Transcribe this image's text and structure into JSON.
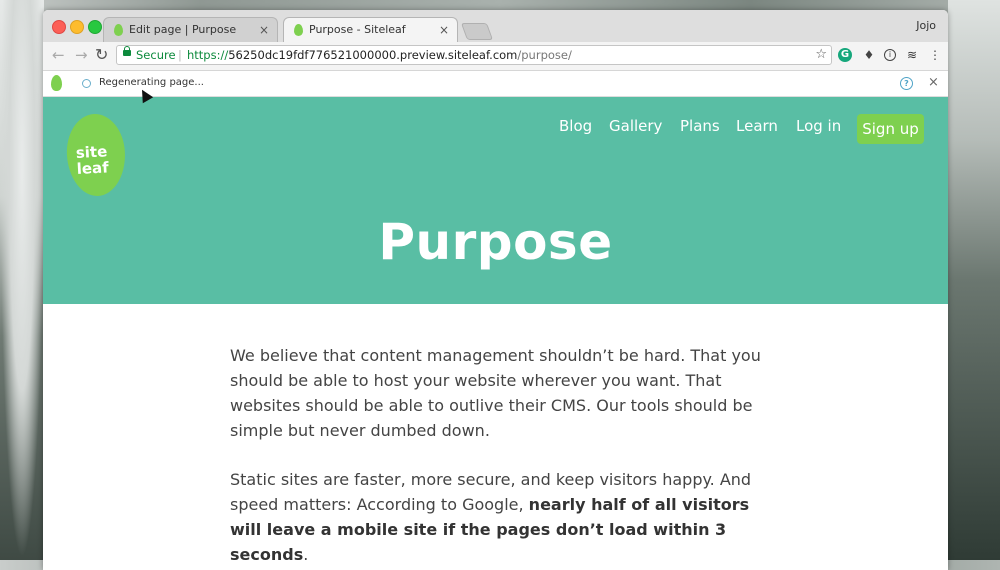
{
  "browser": {
    "tabs": [
      {
        "title": "Edit page | Purpose",
        "close": "×"
      },
      {
        "title": "Purpose - Siteleaf",
        "close": "×"
      }
    ],
    "profile": "Jojo",
    "nav": {
      "back": "←",
      "forward": "→",
      "reload": "↻"
    },
    "address": {
      "secure_label": "Secure",
      "separator": "|",
      "scheme": "https://",
      "host": "56250dc19fdf776521000000.preview.siteleaf.com",
      "path": "/purpose/"
    },
    "bookmark": "☆",
    "extensions": {
      "g": "G",
      "drop": "♦",
      "info": "i",
      "stack": "≋",
      "menu": "⋮"
    }
  },
  "siteleaf_bar": {
    "status": "Regenerating page...",
    "help": "?",
    "close": "×"
  },
  "site": {
    "logo": {
      "line1": "site",
      "line2": "leaf"
    },
    "nav": [
      "Blog",
      "Gallery",
      "Plans",
      "Learn",
      "Log in"
    ],
    "signup": "Sign up",
    "title": "Purpose",
    "paragraph1": "We believe that content management shouldn’t be hard. That you should be able to host your website wherever you want. That websites should be able to outlive their CMS. Our tools should be simple but never dumbed down.",
    "paragraph2_start": "Static sites are faster, more secure, and keep visitors happy. And speed matters: According to Google, ",
    "paragraph2_bold": "nearly half of all visitors will leave a mobile site if the pages don’t load within 3 seconds",
    "paragraph2_end": "."
  },
  "colors": {
    "hero": "#59bea4",
    "brand_green": "#7ed04f",
    "secure_green": "#0c8a3c"
  }
}
